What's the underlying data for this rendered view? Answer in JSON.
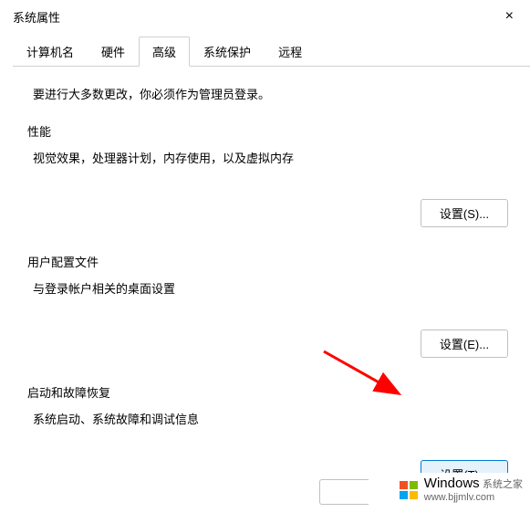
{
  "title": "系统属性",
  "closeGlyph": "×",
  "tabs": {
    "computerName": "计算机名",
    "hardware": "硬件",
    "advanced": "高级",
    "systemProtection": "系统保护",
    "remote": "远程"
  },
  "intro": "要进行大多数更改，你必须作为管理员登录。",
  "performance": {
    "title": "性能",
    "desc": "视觉效果，处理器计划，内存使用，以及虚拟内存",
    "button": "设置(S)..."
  },
  "userProfile": {
    "title": "用户配置文件",
    "desc": "与登录帐户相关的桌面设置",
    "button": "设置(E)..."
  },
  "startup": {
    "title": "启动和故障恢复",
    "desc": "系统启动、系统故障和调试信息",
    "button": "设置(T)..."
  },
  "watermark": {
    "main": "Windows",
    "sub": "系统之家",
    "url": "www.bjjmlv.com"
  }
}
